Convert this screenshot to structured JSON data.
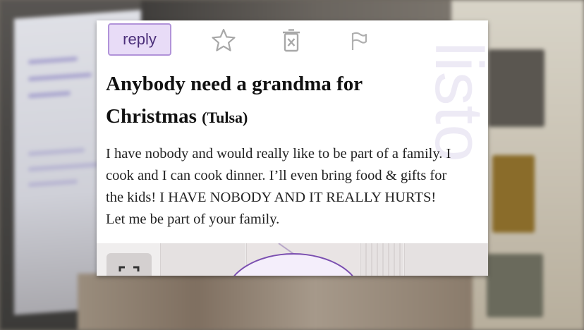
{
  "toolbar": {
    "reply_label": "reply",
    "icons": [
      "star-icon",
      "trash-icon",
      "flag-icon"
    ]
  },
  "post": {
    "title": "Anybody need a grandma for Christmas",
    "location": "(Tulsa)",
    "body": "I have nobody and would really like to be part of a family. I cook and I can cook dinner. I’ll even bring food & gifts for the kids! I HAVE NOBODY AND IT REALLY HURTS! Let me be part of your family."
  },
  "colors": {
    "reply_bg": "#e8dcf7",
    "reply_border": "#b193d9",
    "reply_text": "#4b2f7a",
    "icon_gray": "#aaaaaa"
  }
}
